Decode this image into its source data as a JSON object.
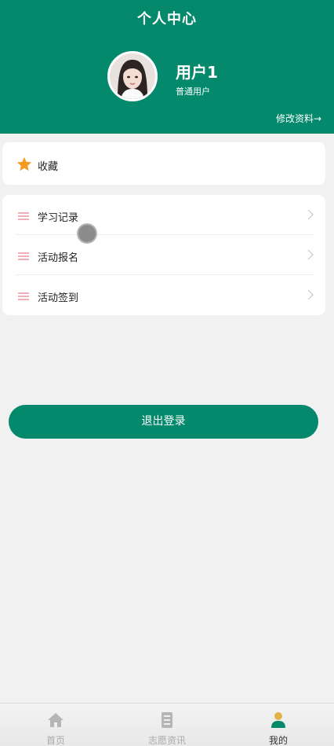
{
  "header": {
    "title": "个人中心",
    "user_name": "用户1",
    "user_role": "普通用户",
    "edit_link": "修改资料→"
  },
  "favorites": {
    "label": "收藏",
    "icon": "star-icon",
    "icon_color": "#f39a1f"
  },
  "menu": {
    "items": [
      {
        "label": "学习记录",
        "icon": "list-icon"
      },
      {
        "label": "活动报名",
        "icon": "list-icon"
      },
      {
        "label": "活动签到",
        "icon": "list-icon"
      }
    ]
  },
  "logout_label": "退出登录",
  "bottom_nav": {
    "items": [
      {
        "label": "首页",
        "icon": "home-icon"
      },
      {
        "label": "志愿资讯",
        "icon": "document-icon"
      },
      {
        "label": "我的",
        "icon": "user-icon",
        "active": true
      }
    ]
  },
  "colors": {
    "primary": "#04896c",
    "menu_icon": "#f2aeb6",
    "background": "#f1f1f1"
  }
}
